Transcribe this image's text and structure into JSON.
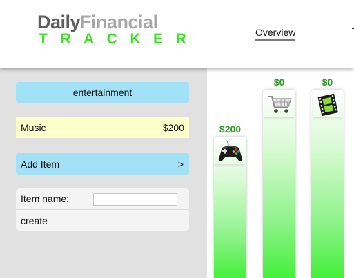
{
  "header": {
    "logo_word1": "Daily",
    "logo_word2": "Financial",
    "logo_sub": "TRACKER",
    "nav_overview": "Overview"
  },
  "sidebar": {
    "category_label": "entertainment",
    "item": {
      "name": "Music",
      "amount": "$200"
    },
    "add_item_label": "Add Item",
    "add_item_chevron": ">",
    "form": {
      "item_name_label": "Item name:",
      "item_name_value": "",
      "create_label": "create"
    }
  },
  "chart": {
    "bars": [
      {
        "label": "$200",
        "icon": "gamepad-icon",
        "level": 1.0
      },
      {
        "label": "$0",
        "icon": "shopping-cart-icon",
        "level": 0.0
      },
      {
        "label": "$0",
        "icon": "film-icon",
        "level": 0.0
      }
    ]
  },
  "colors": {
    "logo_dark": "#5e5e5e",
    "logo_light": "#a6a6a6",
    "logo_green": "#35e61f",
    "accent_blue": "#a3e1f6",
    "item_yellow": "#ffffcc",
    "bar_green": "#44f03b",
    "value_green": "#2f9b28"
  }
}
